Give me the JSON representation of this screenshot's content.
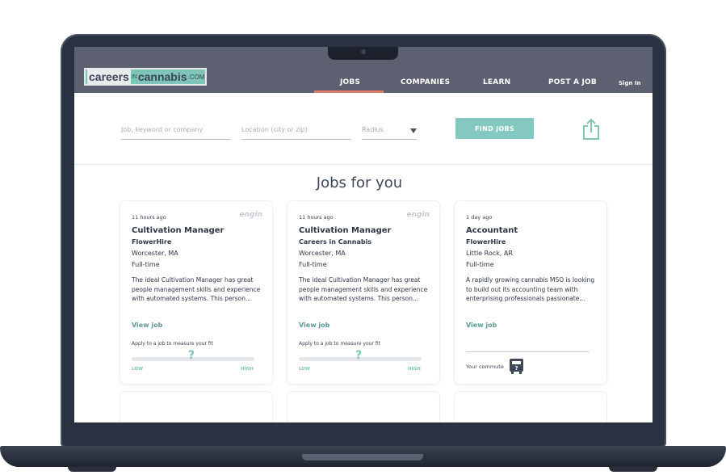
{
  "brand": {
    "logo_careers": "careers",
    "logo_in": "IN",
    "logo_cannabis": "cannabis",
    "logo_com": ".COM",
    "accent_color": "#84c8c1",
    "nav_color": "#5d6070",
    "active_tab_color": "#e07b6b"
  },
  "nav": {
    "jobs": "JOBS",
    "companies": "COMPANIES",
    "learn": "LEARN",
    "post_job": "POST A JOB",
    "signin": "Sign In",
    "active": "JOBS"
  },
  "search": {
    "keyword_placeholder": "Job, keyword or company",
    "location_placeholder": "Location (city or zip)",
    "radius_placeholder": "Radius",
    "find_button": "FIND JOBS",
    "share_icon": "share-icon"
  },
  "main": {
    "title": "Jobs for you"
  },
  "cards": [
    {
      "time": "11 hours ago",
      "source": "engin",
      "title": "Cultivation Manager",
      "company": "FlowerHire",
      "location": "Worcester, MA",
      "type": "Full-time",
      "description": "The ideal Cultivation Manager has great people management skills and experience with automated systems. This person...",
      "view": "View job",
      "fit_label": "Apply to a job to measure your fit",
      "fit_mark": "?",
      "fit_low": "LOW",
      "fit_high": "HIGH"
    },
    {
      "time": "11 hours ago",
      "source": "engin",
      "title": "Cultivation Manager",
      "company": "Careers in Cannabis",
      "location": "Worcester, MA",
      "type": "Full-time",
      "description": "The ideal Cultivation Manager has great people management skills and experience with automated systems. This person...",
      "view": "View job",
      "fit_label": "Apply to a job to measure your fit",
      "fit_mark": "?",
      "fit_low": "LOW",
      "fit_high": "HIGH"
    },
    {
      "time": "1 day ago",
      "title": "Accountant",
      "company": "FlowerHire",
      "location": "Little Rock, AR",
      "type": "Full-time",
      "description": "A rapidly growing cannabis MSO is looking to build out its accounting team with enterprising professionals passionate...",
      "view": "View job",
      "commute_label": "Your commute",
      "commute_icon": "transit-icon"
    }
  ]
}
